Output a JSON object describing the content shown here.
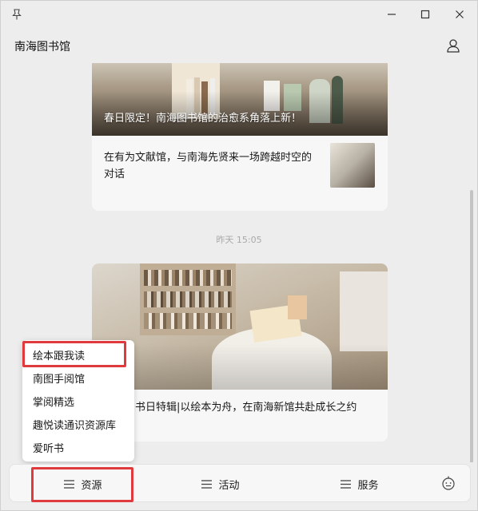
{
  "window": {
    "title": "南海图书馆",
    "controls": [
      "minimize",
      "maximize",
      "close"
    ]
  },
  "feed": {
    "card1": {
      "caption": "春日限定！南海图书馆的治愈系角落上新！",
      "item_text": "在有为文献馆，与南海先贤来一场跨越时空的对话"
    },
    "timestamp": "昨天 15:05",
    "card2": {
      "text": "儿童图书日特辑|以绘本为舟，在南海新馆共赴成长之约"
    }
  },
  "popup_menu": {
    "items": [
      "绘本跟我读",
      "南图手阅馆",
      "掌阅精选",
      "趣悦读通识资源库",
      "爱听书"
    ],
    "highlighted_index": 0
  },
  "bottom_bar": {
    "menus": [
      "资源",
      "活动",
      "服务"
    ],
    "highlighted_index": 0
  },
  "colors": {
    "highlight": "#e0393e",
    "background": "#ededed",
    "card": "#f7f7f7"
  },
  "icons": [
    "pin-icon",
    "minimize-icon",
    "maximize-icon",
    "close-icon",
    "user-icon",
    "menu-list-icon",
    "robot-icon"
  ]
}
